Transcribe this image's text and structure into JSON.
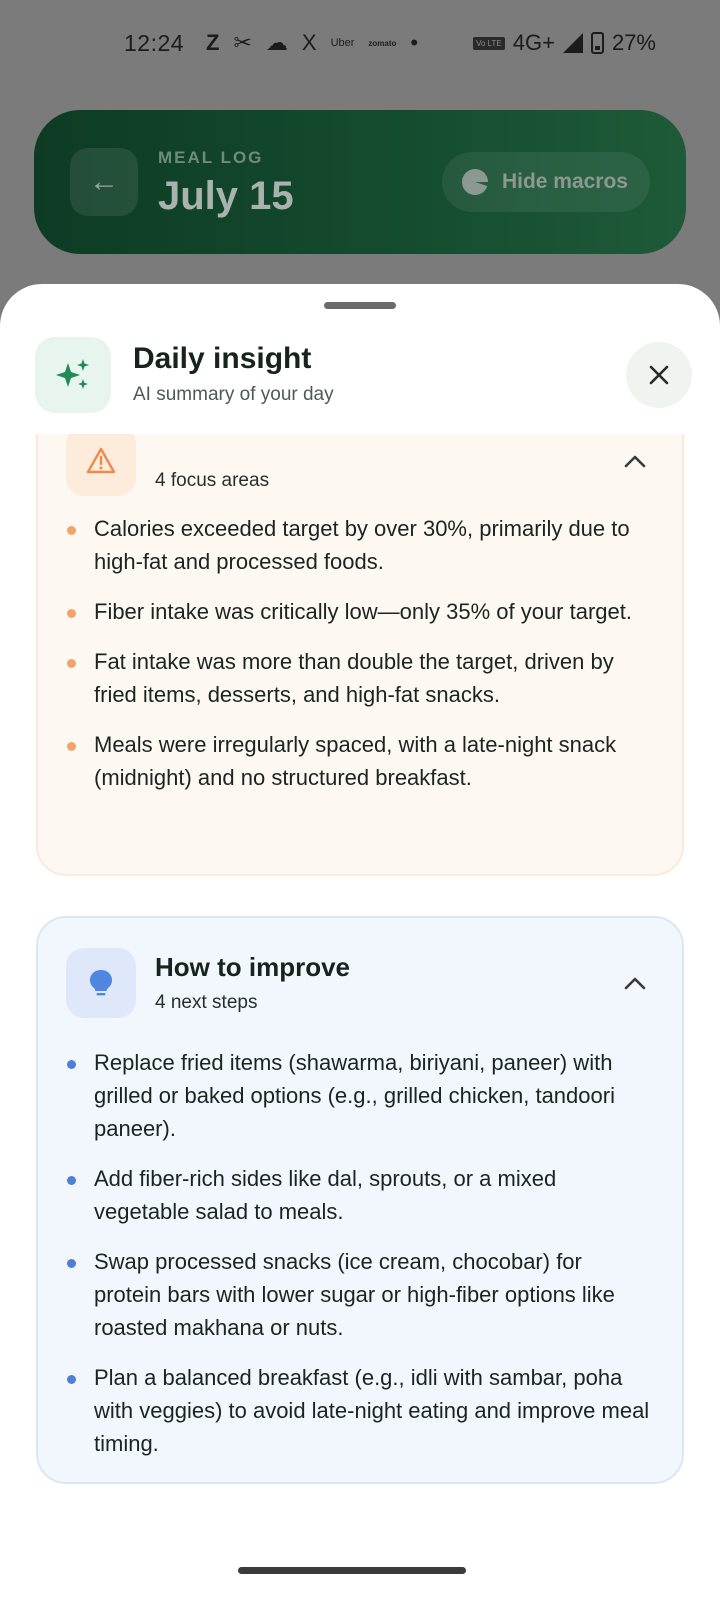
{
  "status_bar": {
    "time": "12:24",
    "app_icons": [
      "Z",
      "✂",
      "☁",
      "X",
      "Uber",
      "zomato",
      "•"
    ],
    "volte": "Vo LTE",
    "network": "4G+",
    "battery": "27%"
  },
  "header": {
    "eyebrow": "MEAL LOG",
    "date": "July 15",
    "back_icon": "arrow-left-icon",
    "macros_button": "Hide macros",
    "macros_icon": "pie-chart-icon",
    "gradient_colors": [
      "#0e3b25",
      "#1e5a38"
    ]
  },
  "sheet": {
    "title": "Daily insight",
    "subtitle": "AI summary of your day",
    "icon": "sparkles-icon",
    "close_icon": "close-icon",
    "accent": "#1f8a56"
  },
  "focus_card": {
    "subtitle": "4 focus areas",
    "icon": "warning-icon",
    "accent": "#f1a36a",
    "items": [
      "Calories exceeded target by over 30%, primarily due to high-fat and processed foods.",
      "Fiber intake was critically low—only 35% of your target.",
      "Fat intake was more than double the target, driven by fried items, desserts, and high-fat snacks.",
      "Meals were irregularly spaced, with a late-night snack (midnight) and no structured breakfast."
    ]
  },
  "improve_card": {
    "title": "How to improve",
    "subtitle": "4 next steps",
    "icon": "lightbulb-icon",
    "accent": "#4f7ed8",
    "items": [
      "Replace fried items (shawarma, biriyani, paneer) with grilled or baked options (e.g., grilled chicken, tandoori paneer).",
      "Add fiber-rich sides like dal, sprouts, or a mixed vegetable salad to meals.",
      "Swap processed snacks (ice cream, chocobar) for protein bars with lower sugar or high-fiber options like roasted makhana or nuts.",
      "Plan a balanced breakfast (e.g., idli with sambar, poha with veggies) to avoid late-night eating and improve meal timing."
    ]
  }
}
